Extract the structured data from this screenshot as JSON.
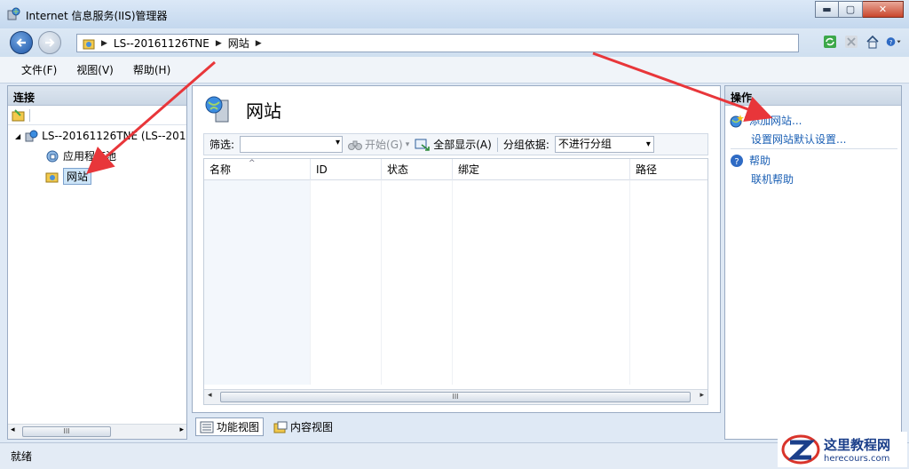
{
  "window": {
    "title": "Internet 信息服务(IIS)管理器",
    "minimize": "▬",
    "maximize": "▢",
    "close": "✕"
  },
  "address": {
    "segments": [
      "LS--20161126TNE",
      "网站"
    ],
    "sep": "▶"
  },
  "menu": [
    "文件(F)",
    "视图(V)",
    "帮助(H)"
  ],
  "connections": {
    "header": "连接",
    "tree": [
      {
        "label": "LS--20161126TNE (LS--201",
        "expander": "◢"
      },
      {
        "label": "应用程序池"
      },
      {
        "label": "网站"
      }
    ]
  },
  "main": {
    "title": "网站",
    "filter": {
      "label": "筛选:",
      "start": "开始(G)",
      "show_all": "全部显示(A)",
      "group_label": "分组依据:",
      "group_value": "不进行分组"
    },
    "columns": [
      "名称",
      "ID",
      "状态",
      "绑定",
      "路径"
    ],
    "scroll_grip": "III"
  },
  "view_tabs": [
    "功能视图",
    "内容视图"
  ],
  "actions": {
    "header": "操作",
    "items": [
      "添加网站...",
      "设置网站默认设置...",
      "帮助",
      "联机帮助"
    ]
  },
  "status": "就绪",
  "watermark": {
    "cn": "这里教程网",
    "en": "herecours.com"
  },
  "colors": {
    "annotation_arrow": "#e8363a",
    "link": "#1a5fb4"
  }
}
